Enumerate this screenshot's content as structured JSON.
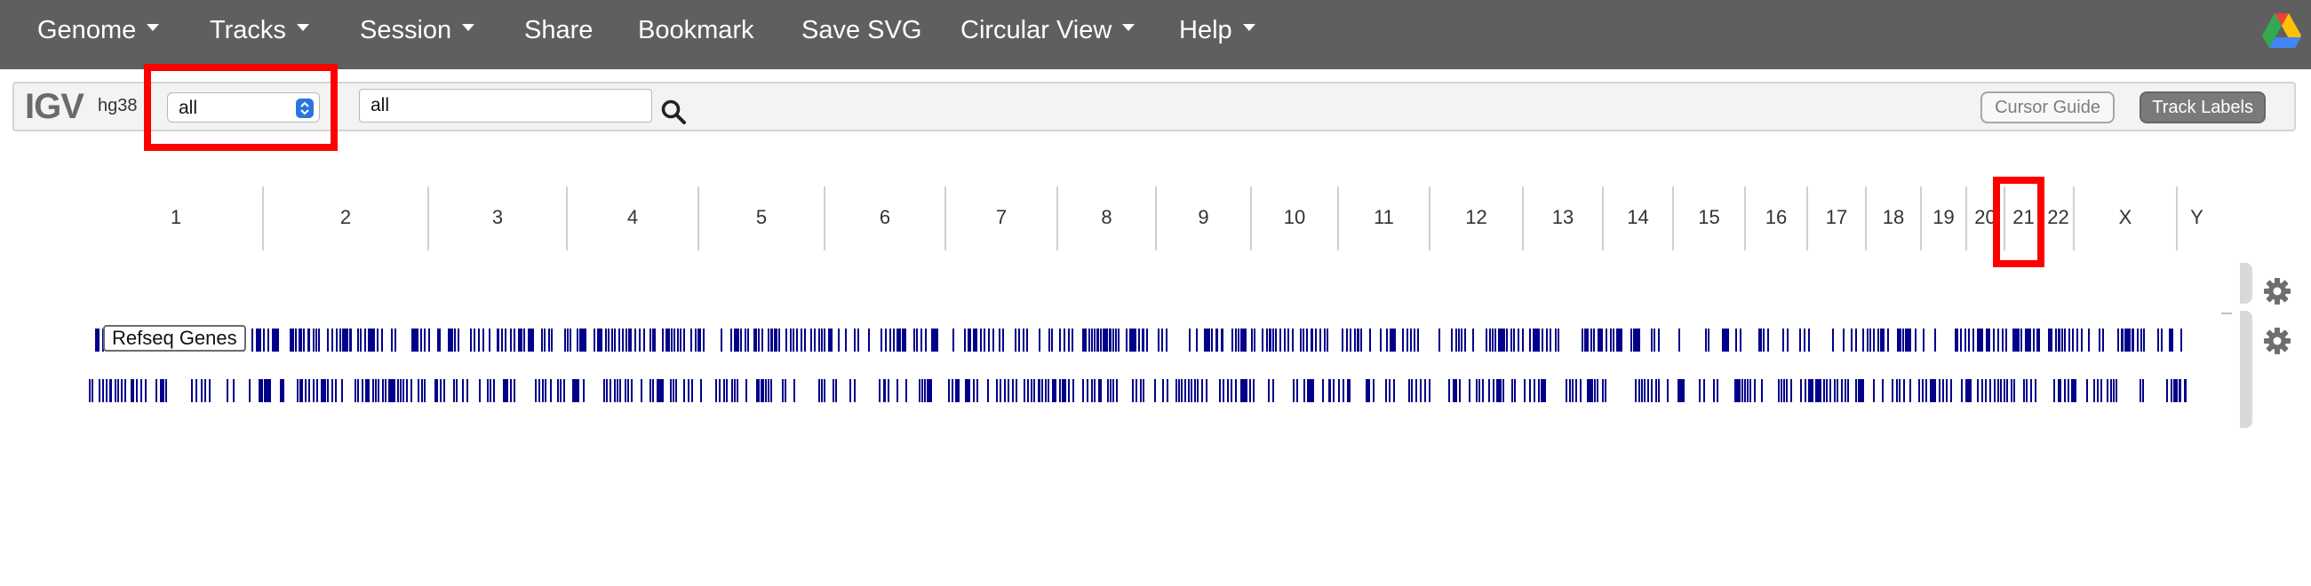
{
  "navbar": {
    "items": [
      {
        "label": "Genome",
        "dropdown": true
      },
      {
        "label": "Tracks",
        "dropdown": true
      },
      {
        "label": "Session",
        "dropdown": true
      },
      {
        "label": "Share",
        "dropdown": false
      },
      {
        "label": "Bookmark",
        "dropdown": false
      },
      {
        "label": "Save SVG",
        "dropdown": false
      },
      {
        "label": "Circular View",
        "dropdown": true
      },
      {
        "label": "Help",
        "dropdown": true
      }
    ],
    "right_icon": "google-drive-icon"
  },
  "toolbar": {
    "logo": "IGV",
    "genome": "hg38",
    "chromosome_select": "all",
    "locus_value": "all",
    "search_icon": "search-icon",
    "cursor_guide_label": "Cursor Guide",
    "track_labels_label": "Track Labels"
  },
  "chromosomes": [
    "1",
    "2",
    "3",
    "4",
    "5",
    "6",
    "7",
    "8",
    "9",
    "10",
    "11",
    "12",
    "13",
    "14",
    "15",
    "16",
    "17",
    "18",
    "19",
    "20",
    "21",
    "22",
    "X",
    "Y"
  ],
  "tracks": [
    {
      "name": "Refseq Genes",
      "color": "#00008b",
      "label_visible": true
    },
    {
      "name": "",
      "color": "#00008b",
      "label_visible": false
    }
  ],
  "colors": {
    "navbar_bg": "#5f5f5f",
    "feature": "#00008b",
    "highlight": "#ff0000",
    "select_accent": "#2a76e0"
  },
  "highlights": [
    "chromosome-select",
    "chromosome-21"
  ]
}
